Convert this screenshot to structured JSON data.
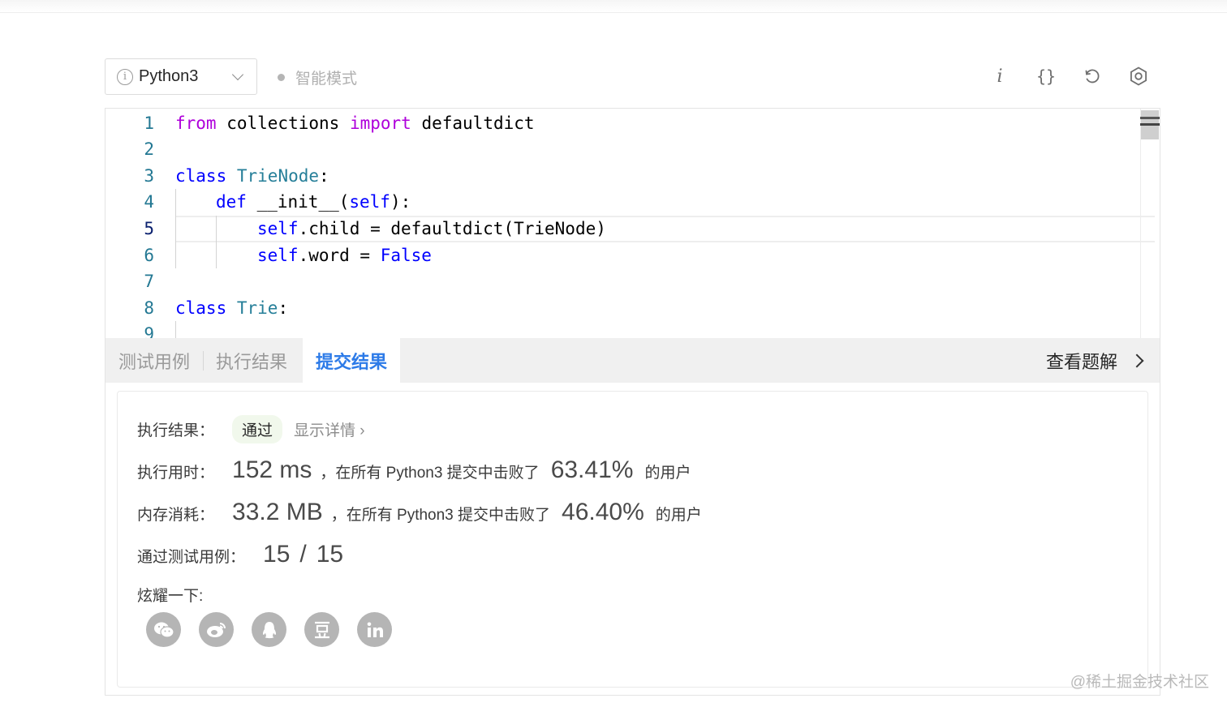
{
  "toolbar": {
    "language": "Python3",
    "mode_label": "智能模式",
    "info_symbol": "i",
    "braces_symbol": "{}"
  },
  "editor": {
    "line_numbers": [
      "1",
      "2",
      "3",
      "4",
      "5",
      "6",
      "7",
      "8",
      "9"
    ],
    "tokens": {
      "l1": [
        "from",
        " collections ",
        "import",
        " defaultdict"
      ],
      "l3": [
        "class",
        " ",
        "TrieNode",
        ":"
      ],
      "l4": [
        "def",
        " __init__(",
        "self",
        "):"
      ],
      "l5": [
        "self",
        ".child = defaultdict(TrieNode)"
      ],
      "l6": [
        "self",
        ".word = ",
        "False"
      ],
      "l8": [
        "class",
        " ",
        "Trie",
        ":"
      ]
    }
  },
  "tabs": {
    "test_cases": "测试用例",
    "run_result": "执行结果",
    "submit_result": "提交结果",
    "view_solution": "查看题解"
  },
  "result": {
    "status_label": "执行结果：",
    "status_badge": "通过",
    "show_detail": "显示详情 ›",
    "time_label": "执行用时：",
    "time_value": "152 ms",
    "time_text_before": "，在所有 Python3 提交中击败了",
    "time_percent": "63.41%",
    "time_text_after": "的用户",
    "memory_label": "内存消耗：",
    "memory_value": "33.2 MB",
    "memory_text_before": "，在所有 Python3 提交中击败了",
    "memory_percent": "46.40%",
    "memory_text_after": "的用户",
    "cases_label": "通过测试用例：",
    "cases_passed": "15",
    "cases_separator": "/",
    "cases_total": "15",
    "share_label": "炫耀一下:"
  },
  "share_icons": [
    "wechat-icon",
    "weibo-icon",
    "qq-icon",
    "douban-icon",
    "linkedin-icon"
  ],
  "watermark": "@稀土掘金技术社区",
  "colors": {
    "accent": "#2d7be8",
    "keyword": "#0000ff",
    "keyword_import": "#af00db",
    "class_name": "#267f99",
    "pass_badge_bg": "#f1f8ec"
  }
}
